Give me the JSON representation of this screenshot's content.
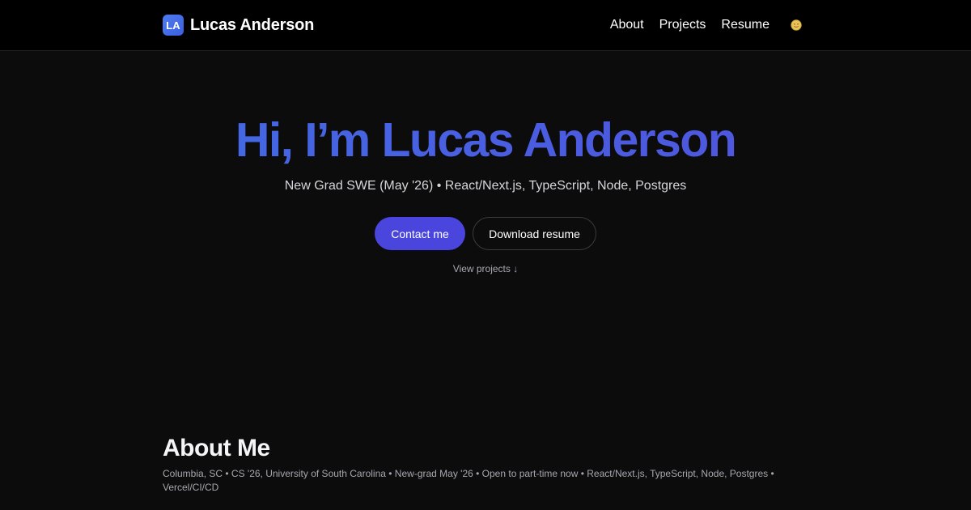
{
  "header": {
    "logo_initials": "LA",
    "brand_name": "Lucas Anderson",
    "nav": [
      {
        "label": "About"
      },
      {
        "label": "Projects"
      },
      {
        "label": "Resume"
      }
    ],
    "theme_toggle_icon": "moon-icon"
  },
  "hero": {
    "title": "Hi, I’m Lucas Anderson",
    "subtitle": "New Grad SWE (May '26) • React/Next.js, TypeScript, Node, Postgres",
    "primary_button": "Contact me",
    "secondary_button": "Download resume",
    "view_projects": "View projects ↓"
  },
  "about": {
    "heading": "About Me",
    "meta": "Columbia, SC • CS '26, University of South Carolina • New-grad May '26 • Open to part-time now • React/Next.js, TypeScript, Node, Postgres • Vercel/CI/CD"
  },
  "colors": {
    "background": "#0c0c0d",
    "header_background": "#000000",
    "accent": "#4a45dd",
    "title_gradient_start": "#3f6fe6",
    "title_gradient_end": "#5152dc"
  }
}
